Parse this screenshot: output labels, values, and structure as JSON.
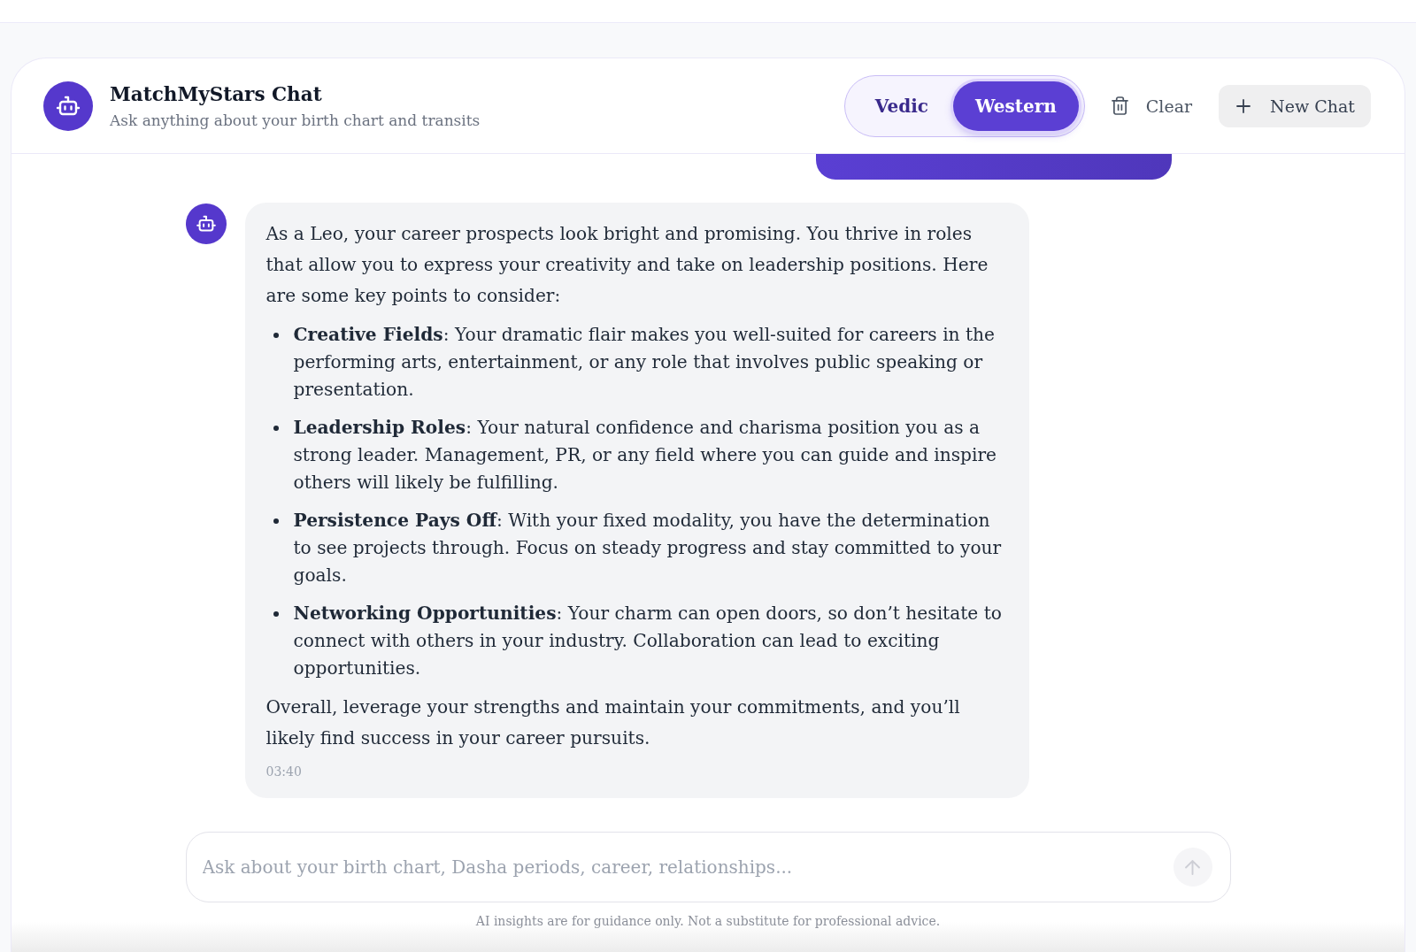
{
  "header": {
    "title": "MatchMyStars Chat",
    "subtitle": "Ask anything about your birth chart and transits"
  },
  "mode_toggle": [
    {
      "label": "Vedic",
      "selected": false
    },
    {
      "label": "Western",
      "selected": true
    }
  ],
  "actions": [
    {
      "kind": "clear",
      "label": "Clear"
    },
    {
      "kind": "new_chat",
      "label": "New Chat"
    }
  ],
  "messages": [
    {
      "kind": "user"
    },
    {
      "kind": "assistant",
      "intro": "As a Leo, your career prospects look bright and promising. You thrive in roles that allow you to express your creativity and take on leadership positions. Here are some key points to consider:",
      "points": [
        "**Creative Fields**: Your dramatic flair makes you well-suited for careers in the performing arts, entertainment, or any role that involves public speaking or presentation.",
        "**Leadership Roles**: Your natural confidence and charisma position you as a strong leader. Management, PR, or any field where you can guide and inspire others will likely be fulfilling.",
        "**Persistence Pays Off**: With your fixed modality, you have the determination to see projects through. Focus on steady progress and stay committed to your goals.",
        "**Networking Opportunities**: Your charm can open doors, so don’t hesitate to connect with others in your industry. Collaboration can lead to exciting opportunities."
      ],
      "closing": "Overall, leverage your strengths and maintain your commitments, and you’ll likely find success in your career pursuits.",
      "time": "03:40"
    }
  ],
  "composer": {
    "placeholder": "Ask about your birth chart, Dasha periods, career, relationships...",
    "send_button": {
      "disabled": true
    }
  },
  "disclaimer": "AI insights are for guidance only. Not a substitute for professional advice."
}
